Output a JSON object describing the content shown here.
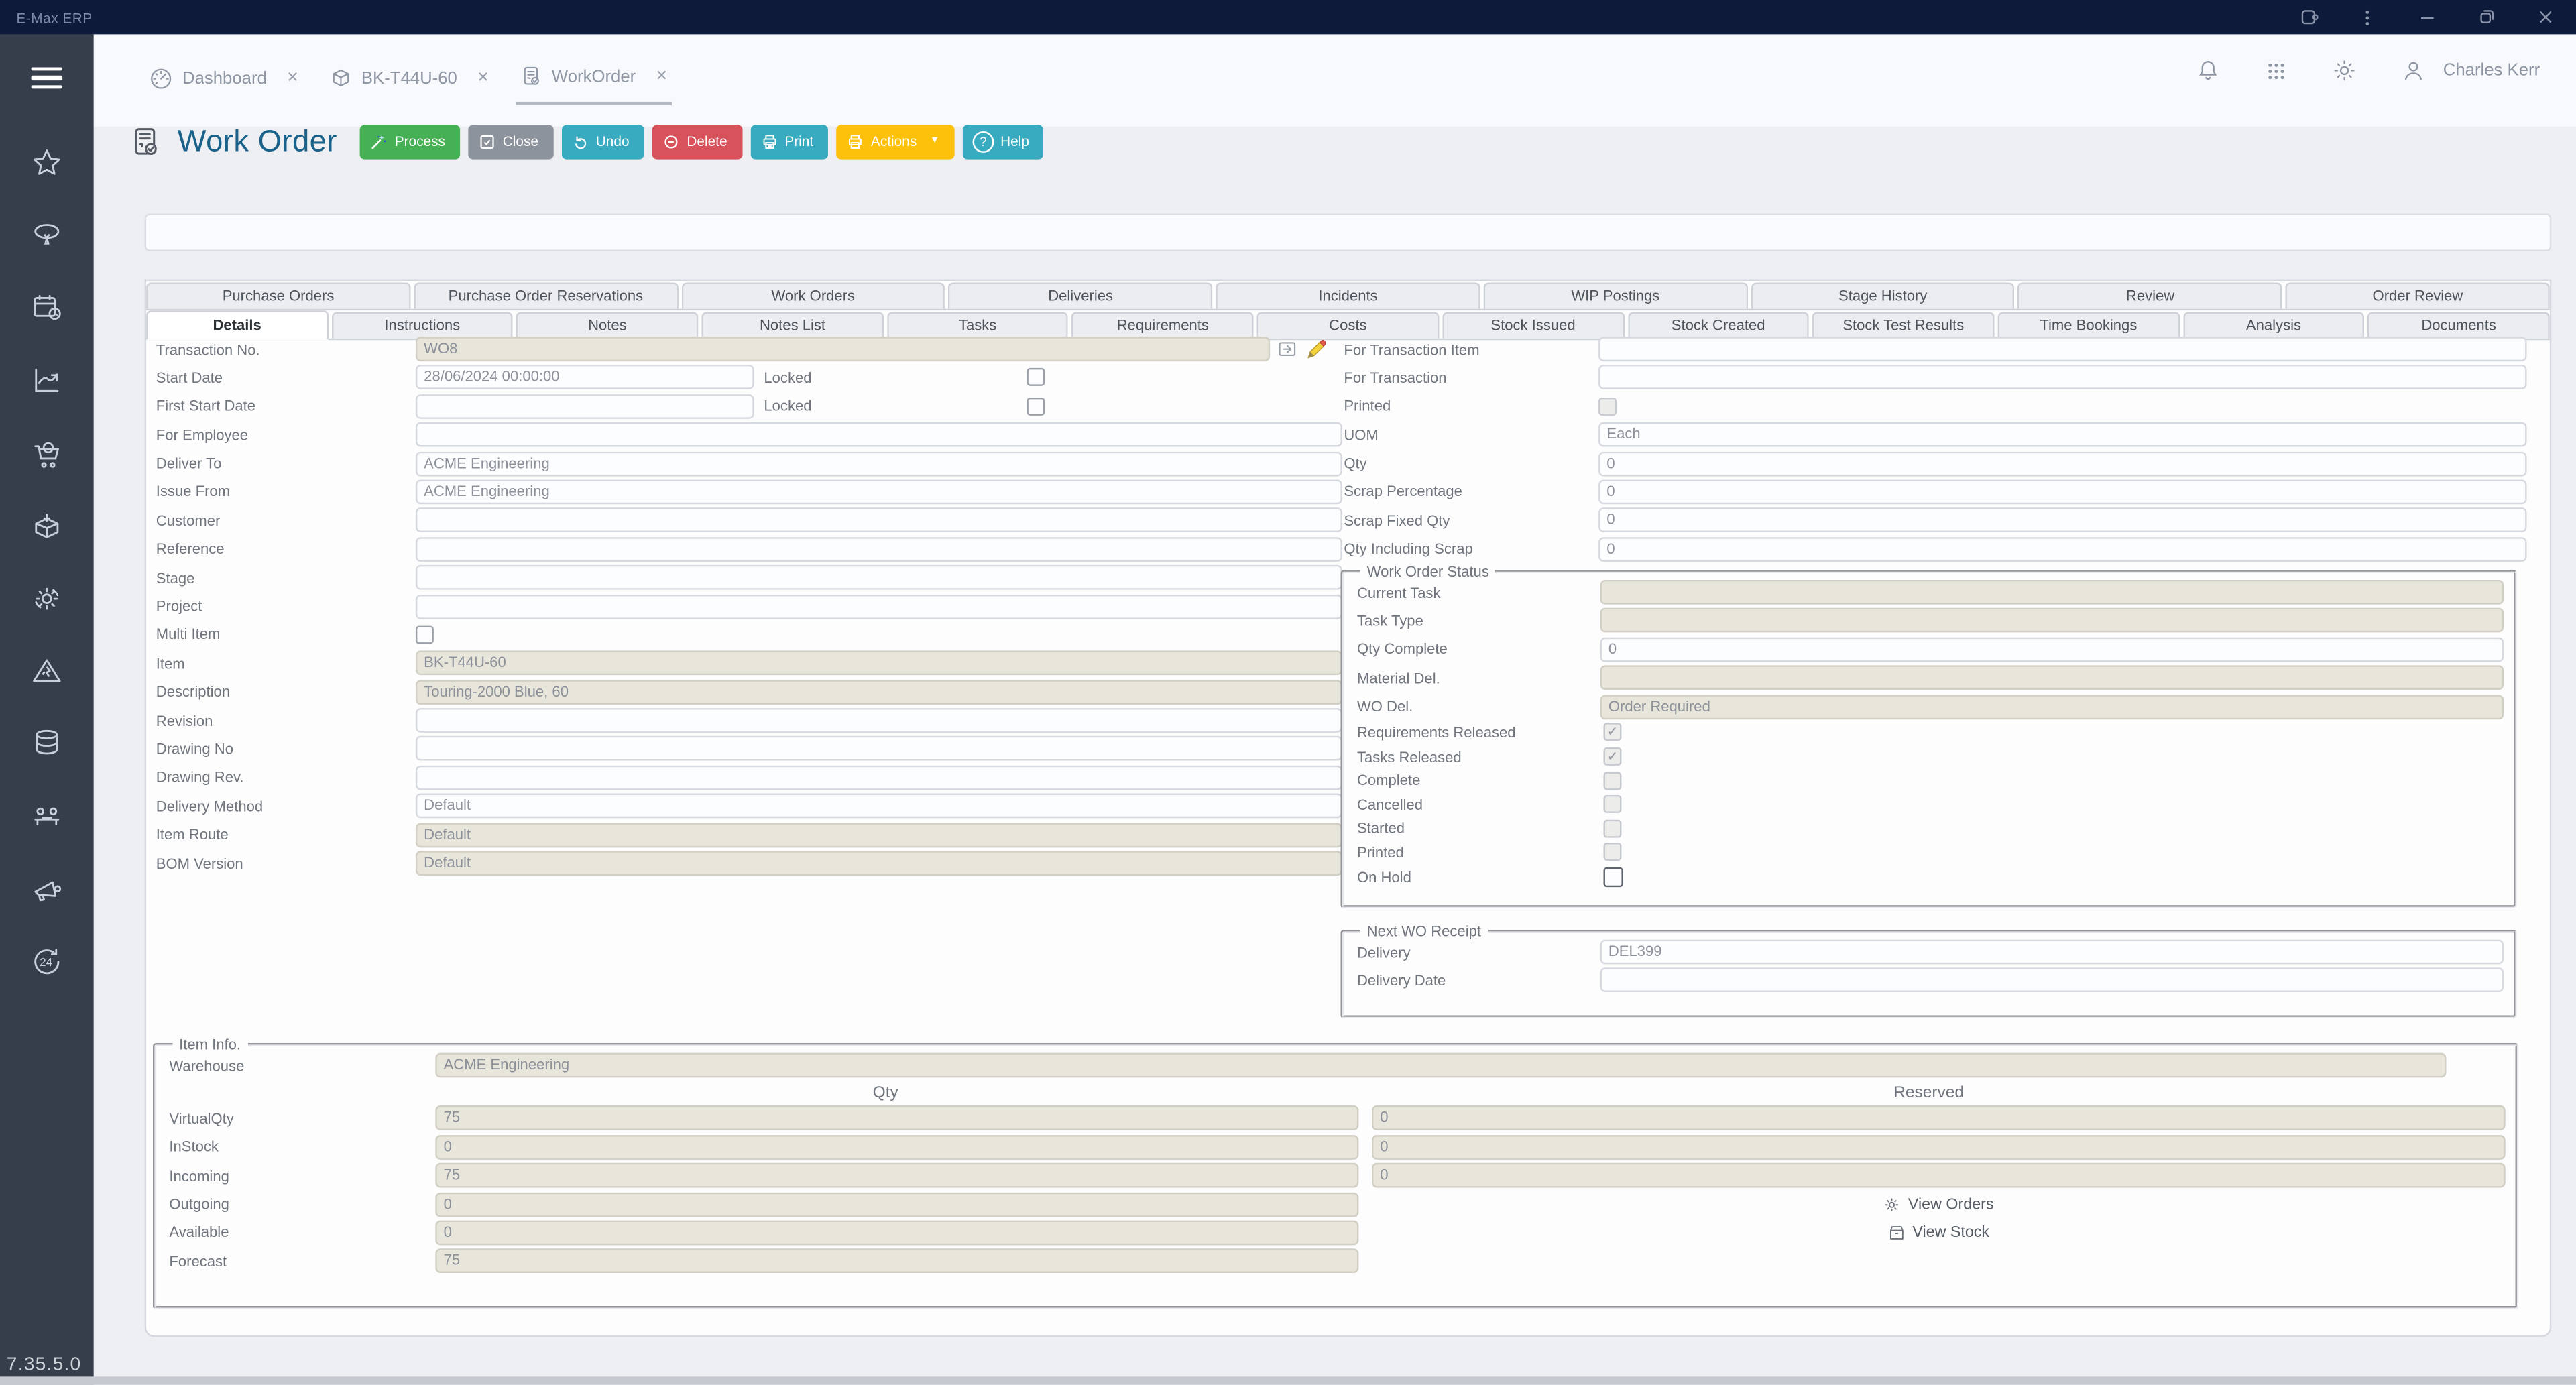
{
  "colors": {
    "topbar": "#0d1a3a",
    "sidebar": "#363e4c",
    "title_blue": "#1b628b",
    "process_green": "#45b054",
    "close_gray": "#8d939c",
    "teal": "#38abc0",
    "delete_red": "#d8525b",
    "actions_amber": "#fdc10b",
    "readonly_field": "#e8e5db"
  },
  "titlebar": {
    "app_title": "E-Max ERP"
  },
  "nav": {
    "tabs": [
      {
        "label": "Dashboard"
      },
      {
        "label": "BK-T44U-60"
      },
      {
        "label": "WorkOrder"
      }
    ],
    "close_glyph": "✕",
    "user_name": "Charles Kerr"
  },
  "page": {
    "title": "Work Order",
    "version": "7.35.5.0"
  },
  "toolbar": {
    "buttons": [
      {
        "label": "Process"
      },
      {
        "label": "Close"
      },
      {
        "label": "Undo"
      },
      {
        "label": "Delete"
      },
      {
        "label": "Print"
      },
      {
        "label": "Actions"
      },
      {
        "label": "Help"
      }
    ],
    "dropdown_glyph": "▼",
    "help_glyph": "?"
  },
  "section_tabs_row1": [
    {
      "label": "Purchase Orders"
    },
    {
      "label": "Purchase Order Reservations"
    },
    {
      "label": "Work Orders"
    },
    {
      "label": "Deliveries"
    },
    {
      "label": "Incidents"
    },
    {
      "label": "WIP Postings"
    },
    {
      "label": "Stage History"
    },
    {
      "label": "Review"
    },
    {
      "label": "Order Review"
    }
  ],
  "section_tabs_row2": [
    {
      "label": "Details"
    },
    {
      "label": "Instructions"
    },
    {
      "label": "Notes"
    },
    {
      "label": "Notes List"
    },
    {
      "label": "Tasks"
    },
    {
      "label": "Requirements"
    },
    {
      "label": "Costs"
    },
    {
      "label": "Stock Issued"
    },
    {
      "label": "Stock Created"
    },
    {
      "label": "Stock Test Results"
    },
    {
      "label": "Time Bookings"
    },
    {
      "label": "Analysis"
    },
    {
      "label": "Documents"
    }
  ],
  "form_left": {
    "rows": [
      {
        "label": "Transaction No.",
        "value": "WO8"
      },
      {
        "label": "Start Date",
        "value": "28/06/2024 00:00:00",
        "locked_label": "Locked",
        "locked_glyph": ""
      },
      {
        "label": "First Start Date",
        "value": "",
        "locked_label": "Locked",
        "locked_glyph": ""
      },
      {
        "label": "For Employee",
        "value": ""
      },
      {
        "label": "Deliver To",
        "value": "ACME Engineering"
      },
      {
        "label": "Issue From",
        "value": "ACME Engineering"
      },
      {
        "label": "Customer",
        "value": ""
      },
      {
        "label": "Reference",
        "value": ""
      },
      {
        "label": "Stage",
        "value": ""
      },
      {
        "label": "Project",
        "value": ""
      },
      {
        "label": "Multi Item",
        "glyph": ""
      },
      {
        "label": "Item",
        "value": "BK-T44U-60"
      },
      {
        "label": "Description",
        "value": "Touring-2000 Blue, 60"
      },
      {
        "label": "Revision",
        "value": ""
      },
      {
        "label": "Drawing No",
        "value": ""
      },
      {
        "label": "Drawing Rev.",
        "value": ""
      },
      {
        "label": "Delivery Method",
        "value": "Default"
      },
      {
        "label": "Item Route",
        "value": "Default"
      },
      {
        "label": "BOM Version",
        "value": "Default"
      }
    ]
  },
  "form_right": {
    "rows": [
      {
        "label": "For Transaction Item",
        "value": ""
      },
      {
        "label": "For Transaction",
        "value": ""
      },
      {
        "label": "Printed",
        "glyph": ""
      },
      {
        "label": "UOM",
        "value": "Each"
      },
      {
        "label": "Qty",
        "value": "0"
      },
      {
        "label": "Scrap Percentage",
        "value": "0"
      },
      {
        "label": "Scrap Fixed Qty",
        "value": "0"
      },
      {
        "label": "Qty Including Scrap",
        "value": "0"
      }
    ]
  },
  "wo_status": {
    "legend": "Work Order Status",
    "rows": [
      {
        "label": "Current Task",
        "value": ""
      },
      {
        "label": "Task Type",
        "value": ""
      },
      {
        "label": "Qty Complete",
        "value": "0"
      },
      {
        "label": "Material Del.",
        "value": ""
      },
      {
        "label": "WO Del.",
        "value": "Order Required"
      }
    ],
    "checks": [
      {
        "label": "Requirements Released",
        "glyph": "✓"
      },
      {
        "label": "Tasks Released",
        "glyph": "✓"
      },
      {
        "label": "Complete",
        "glyph": ""
      },
      {
        "label": "Cancelled",
        "glyph": ""
      },
      {
        "label": "Started",
        "glyph": ""
      },
      {
        "label": "Printed",
        "glyph": ""
      },
      {
        "label": "On Hold",
        "glyph": ""
      }
    ]
  },
  "next_receipt": {
    "legend": "Next WO Receipt",
    "rows": [
      {
        "label": "Delivery",
        "value": "DEL399"
      },
      {
        "label": "Delivery Date",
        "value": ""
      }
    ]
  },
  "item_info": {
    "legend": "Item Info.",
    "warehouse_label": "Warehouse",
    "warehouse_value": "ACME Engineering",
    "col_qty": "Qty",
    "col_reserved": "Reserved",
    "rows": [
      {
        "label": "VirtualQty",
        "qty": "75",
        "reserved": "0"
      },
      {
        "label": "InStock",
        "qty": "0",
        "reserved": "0"
      },
      {
        "label": "Incoming",
        "qty": "75",
        "reserved": "0"
      },
      {
        "label": "Outgoing",
        "qty": "0"
      },
      {
        "label": "Available",
        "qty": "0"
      },
      {
        "label": "Forecast",
        "qty": "75"
      }
    ],
    "links": [
      {
        "label": "View Orders"
      },
      {
        "label": "View Stock"
      }
    ]
  }
}
